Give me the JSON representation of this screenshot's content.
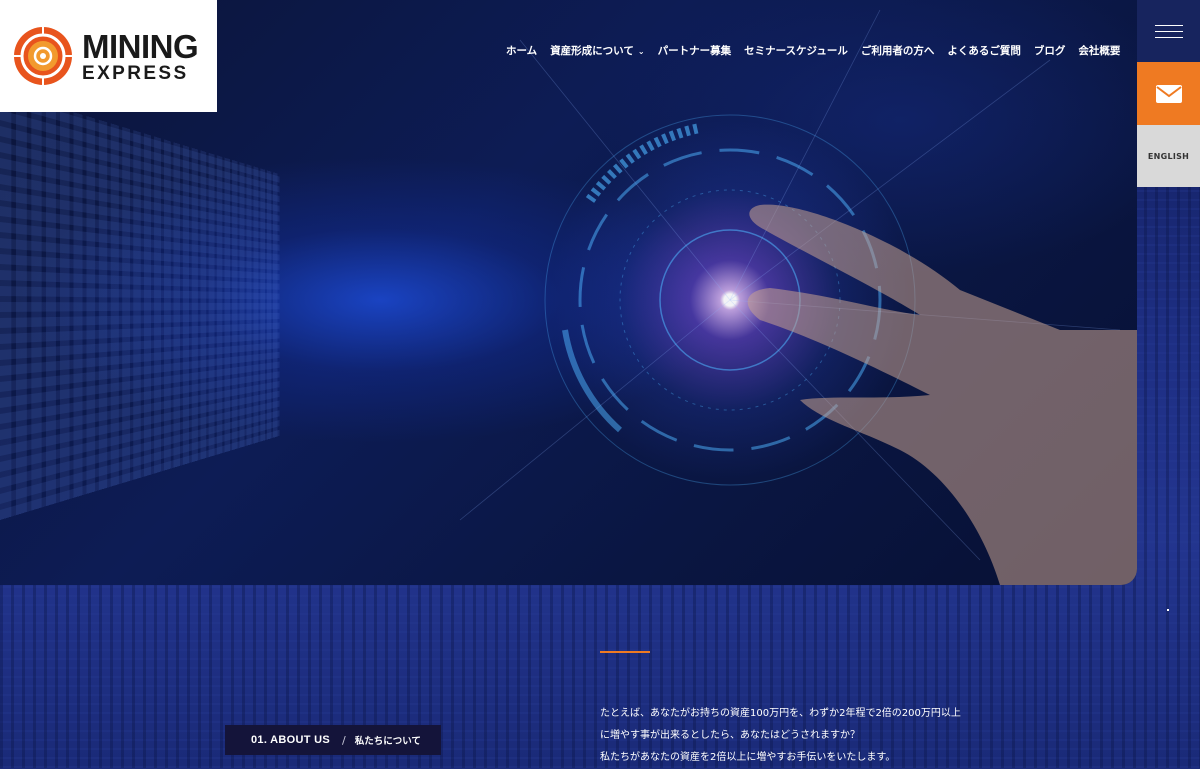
{
  "logo": {
    "line1": "MINING",
    "line2": "EXPRESS",
    "colors": {
      "ring_outer": "#e8541d",
      "ring_inner": "#f29a2e"
    }
  },
  "nav": {
    "items": [
      {
        "label": "ホーム"
      },
      {
        "label": "資産形成について",
        "has_dropdown": true
      },
      {
        "label": "パートナー募集"
      },
      {
        "label": "セミナースケジュール"
      },
      {
        "label": "ご利用者の方へ"
      },
      {
        "label": "よくあるご質問"
      },
      {
        "label": "ブログ"
      },
      {
        "label": "会社概要"
      }
    ]
  },
  "side": {
    "menu_icon": "hamburger-icon",
    "mail_icon": "mail-icon",
    "english_label": "ENGLISH",
    "colors": {
      "menu_bg": "#17245e",
      "mail_bg": "#ef7a22",
      "english_bg": "#d9d9d9"
    }
  },
  "about": {
    "tag_en": "01. ABOUT US",
    "tag_sep": "/",
    "tag_jp": "私たちについて",
    "paragraphs": [
      "たとえば、あなたがお持ちの資産100万円を、わずか2年程で2倍の200万円以上",
      "に増やす事が出来るとしたら、あなたはどうされますか？",
      "私たちがあなたの資産を2倍以上に増やすお手伝いをいたします。"
    ],
    "accent_color": "#ef7a22"
  }
}
